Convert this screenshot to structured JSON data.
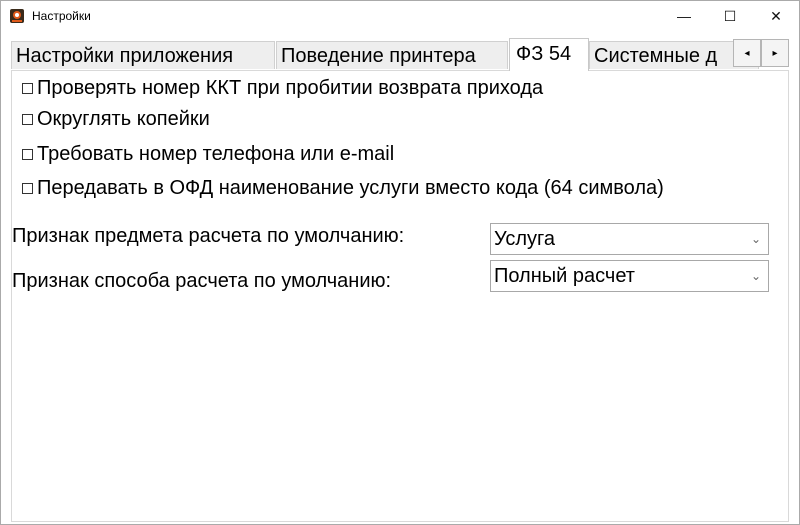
{
  "window": {
    "title": "Настройки",
    "icon": "app-logo-icon",
    "controls": {
      "minimize": "—",
      "maximize": "☐",
      "close": "✕"
    }
  },
  "tabs": [
    {
      "label": "Настройки приложения",
      "active": false
    },
    {
      "label": "Поведение принтера",
      "active": false
    },
    {
      "label": "ФЗ 54",
      "active": true
    },
    {
      "label": "Системные д",
      "active": false
    }
  ],
  "tab_scroll": {
    "left": "◂",
    "right": "▸"
  },
  "checkboxes": [
    {
      "label": "Проверять номер ККТ при пробитии возврата прихода",
      "checked": false
    },
    {
      "label": "Округлять копейки",
      "checked": false
    },
    {
      "label": "Требовать номер телефона или e-mail",
      "checked": false
    },
    {
      "label": "Передавать в ОФД наименование услуги вместо кода (64 символа)",
      "checked": false
    }
  ],
  "fields": {
    "subject": {
      "label": "Признак предмета расчета по умолчанию:",
      "value": "Услуга"
    },
    "method": {
      "label": "Признак способа расчета по умолчанию:",
      "value": "Полный расчет"
    }
  },
  "dropdown_icon": "⌄",
  "colors": {
    "tab_inactive": "#eeeeee",
    "tab_active": "#ffffff",
    "border": "#d9d9d9",
    "accent_logo": "#e05a1a"
  }
}
